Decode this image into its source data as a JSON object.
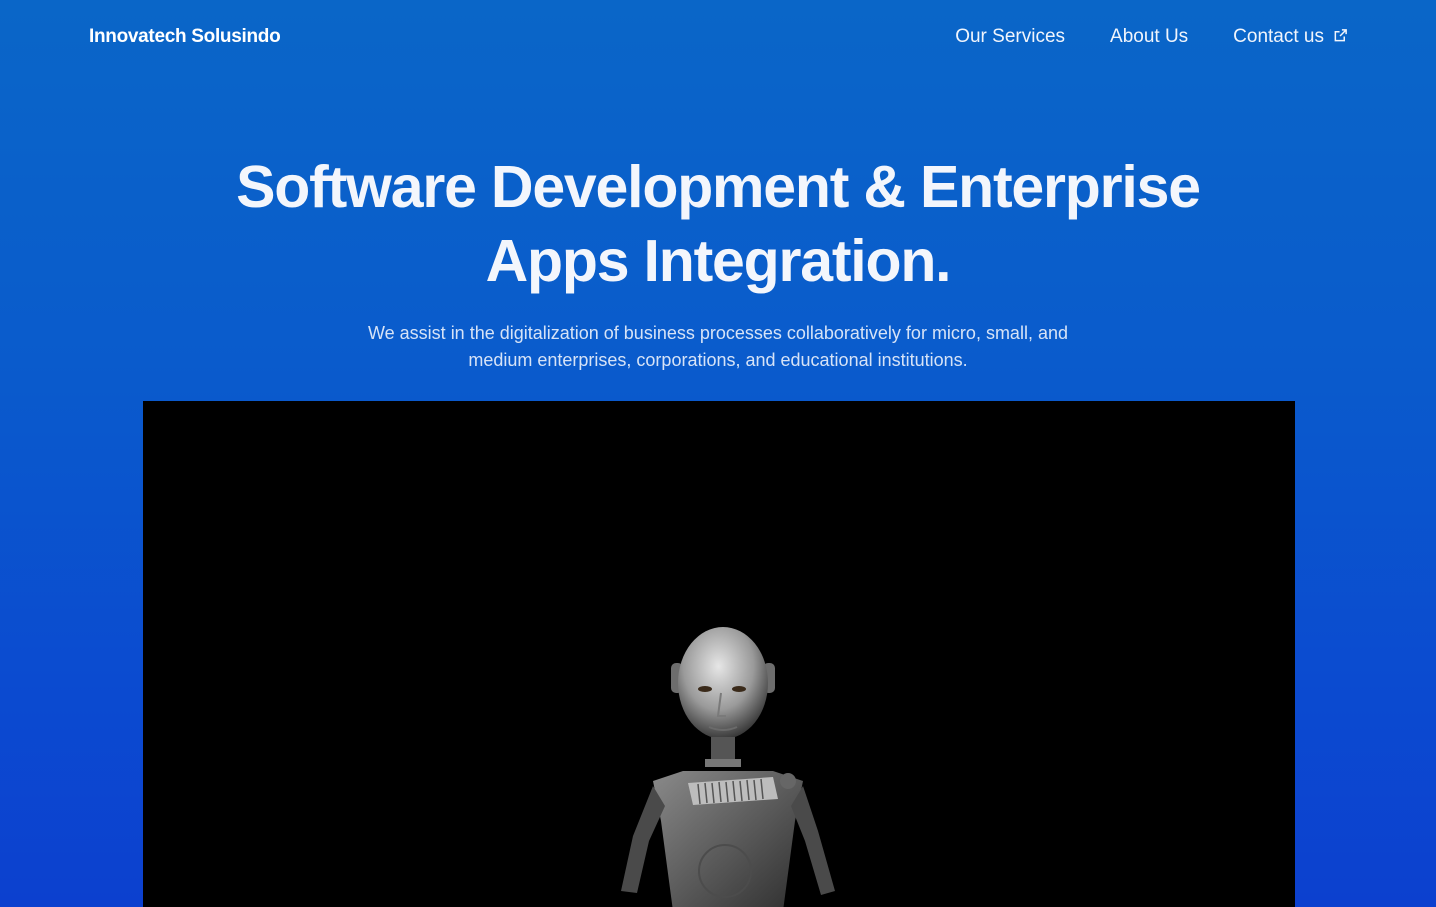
{
  "nav": {
    "brand": "Innovatech Solusindo",
    "links": [
      {
        "label": "Our Services"
      },
      {
        "label": "About Us"
      },
      {
        "label": "Contact us",
        "icon": "external-link-icon"
      }
    ]
  },
  "hero": {
    "title": "Software Development & Enterprise Apps Integration.",
    "subtitle": "We assist in the digitalization of business processes collaboratively for micro, small, and medium enterprises, corporations, and educational institutions."
  },
  "media": {
    "background": "#000000",
    "subject_icon": "robot-icon"
  },
  "colors": {
    "gradient_top": "#0a66c8",
    "gradient_bottom": "#0c40cf",
    "text": "#ffffff"
  }
}
